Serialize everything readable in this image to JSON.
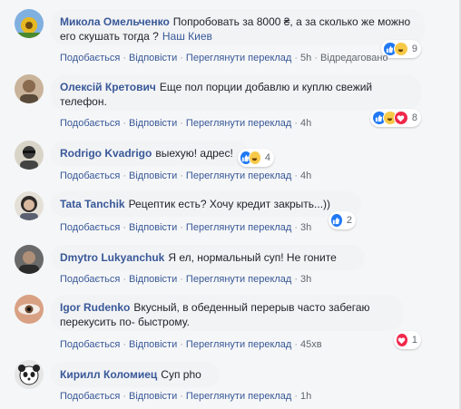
{
  "comments": [
    {
      "author": "Микола Омельченко",
      "text": "Попробовать за 8000 ₴, а за сколько же можно его скушать тогда ?",
      "place": "Наш Киев",
      "actions": [
        "Подобається",
        "Відповісти",
        "Переглянути переклад"
      ],
      "time": "5h",
      "extra": "Відредаговано",
      "reactions": [
        "like",
        "haha"
      ],
      "count": "9"
    },
    {
      "author": "Олексій Кретович",
      "text": "Еще пол порции добавлю и куплю свежий телефон.",
      "actions": [
        "Подобається",
        "Відповісти",
        "Переглянути переклад"
      ],
      "time": "4h",
      "reactions": [
        "like",
        "haha",
        "love"
      ],
      "count": "8"
    },
    {
      "author": "Rodrigo Kvadrigo",
      "text": "выехую! адрес!",
      "actions": [
        "Подобається",
        "Відповісти",
        "Переглянути переклад"
      ],
      "time": "4h",
      "reactions": [
        "like",
        "haha"
      ],
      "count": "4"
    },
    {
      "author": "Tata Tanchik",
      "text": "Рецептик есть? Хочу кредит закрыть...))",
      "actions": [
        "Подобається",
        "Відповісти",
        "Переглянути переклад"
      ],
      "time": "3h",
      "reactions": [
        "like"
      ],
      "count": "2"
    },
    {
      "author": "Dmytro Lukyanchuk",
      "text": "Я ел, нормальный суп! Не гоните",
      "actions": [
        "Подобається",
        "Відповісти",
        "Переглянути переклад"
      ],
      "time": "3h",
      "reactions": [],
      "count": ""
    },
    {
      "author": "Igor Rudenko",
      "text": "Вкусный, в обеденный перерыв часто забегаю перекусить по- быстрому.",
      "actions": [
        "Подобається",
        "Відповісти",
        "Переглянути переклад"
      ],
      "time": "45хв",
      "reactions": [
        "love"
      ],
      "count": "1"
    },
    {
      "author": "Кирилл Коломиец",
      "text": "Суп pho",
      "actions": [
        "Подобається",
        "Відповісти",
        "Переглянути переклад"
      ],
      "time": "1h",
      "reactions": [],
      "count": ""
    }
  ],
  "colors": {
    "link": "#385898",
    "like": "#2078f4",
    "love": "#f0284a",
    "haha": "#f7c948",
    "bubble": "#f2f3f5"
  }
}
